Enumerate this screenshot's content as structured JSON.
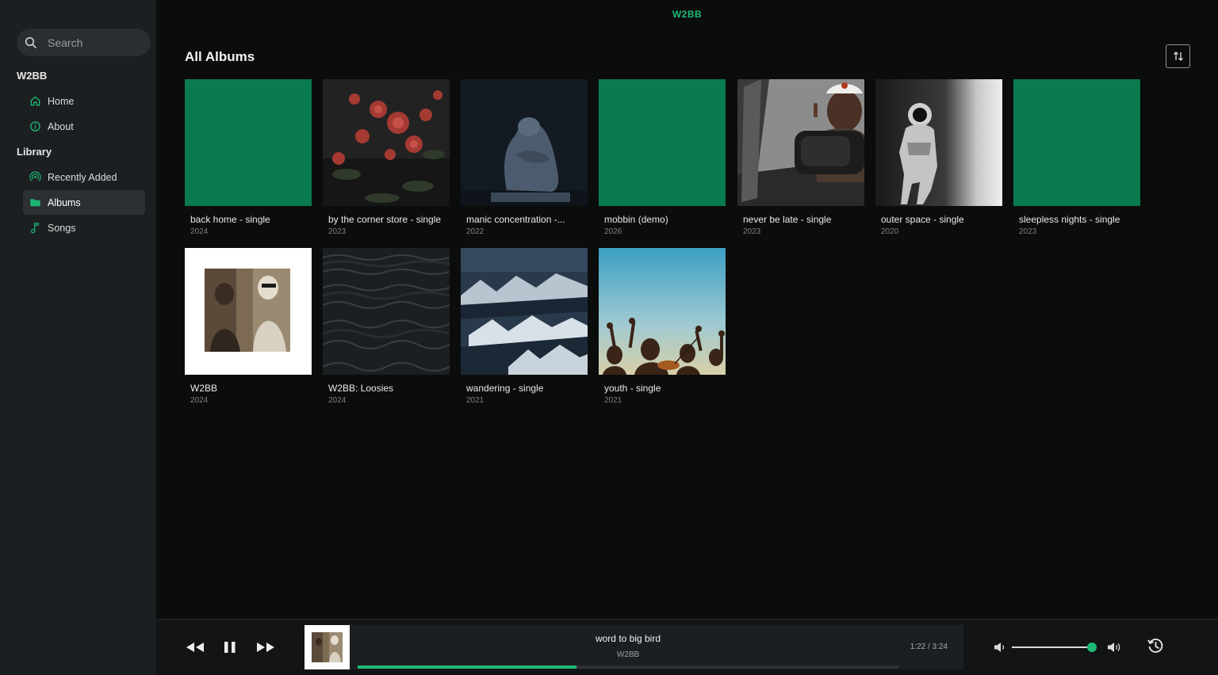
{
  "search": {
    "placeholder": "Search"
  },
  "sidebar": {
    "section1_title": "W2BB",
    "home_label": "Home",
    "about_label": "About",
    "section2_title": "Library",
    "recent_label": "Recently Added",
    "albums_label": "Albums",
    "songs_label": "Songs"
  },
  "header": {
    "brand": "W2BB"
  },
  "main": {
    "title": "All Albums"
  },
  "albums": [
    {
      "name": "back home - single",
      "year": "2024"
    },
    {
      "name": "by the corner store - single",
      "year": "2023"
    },
    {
      "name": "manic concentration -...",
      "year": "2022"
    },
    {
      "name": "mobbin (demo)",
      "year": "2026"
    },
    {
      "name": "never be late - single",
      "year": "2023"
    },
    {
      "name": "outer space - single",
      "year": "2020"
    },
    {
      "name": "sleepless nights - single",
      "year": "2023"
    },
    {
      "name": "W2BB",
      "year": "2024"
    },
    {
      "name": "W2BB: Loosies",
      "year": "2024"
    },
    {
      "name": "wandering - single",
      "year": "2021"
    },
    {
      "name": "youth - single",
      "year": "2021"
    }
  ],
  "player": {
    "title": "word to big bird",
    "artist": "W2BB",
    "time": "1:22 / 3:24",
    "progress_fraction": 0.405,
    "volume_fraction": 0.95
  },
  "colors": {
    "accent": "#1db974",
    "placeholder_cover": "#0a7a4f",
    "background": "#0b0c0c",
    "sidebar": "#1c1f21"
  },
  "icons": [
    "search-icon",
    "home-icon",
    "info-icon",
    "broadcast-icon",
    "folder-icon",
    "music-note-icon",
    "sort-icon",
    "rewind-icon",
    "pause-icon",
    "fast-forward-icon",
    "volume-low-icon",
    "volume-high-icon",
    "history-icon"
  ]
}
